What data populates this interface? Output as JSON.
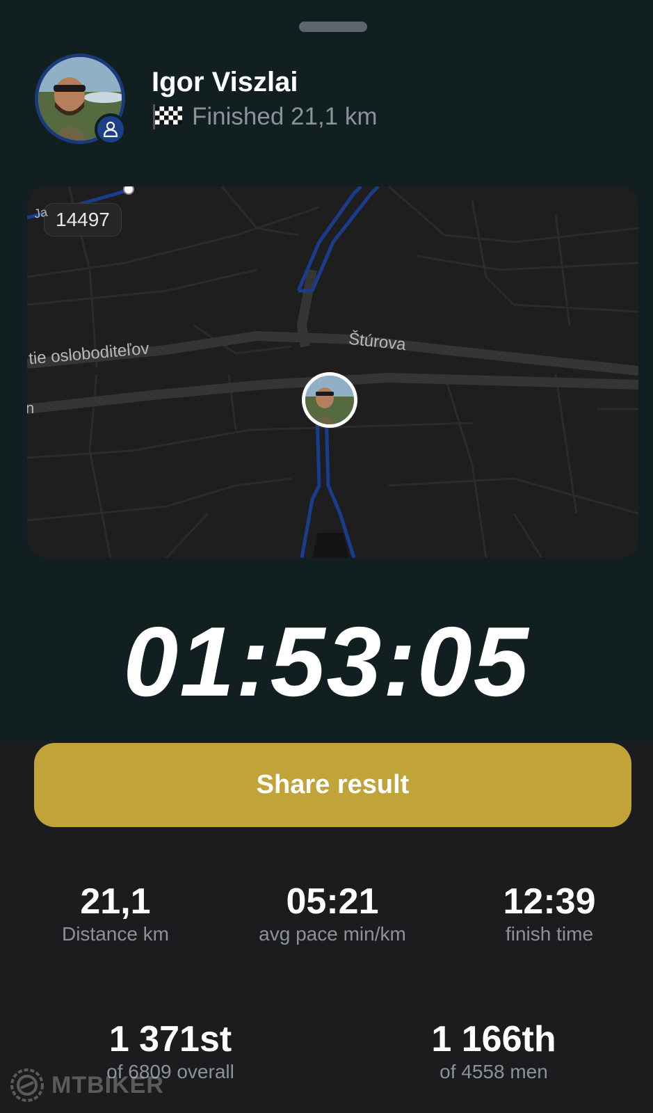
{
  "user": {
    "name": "Igor Viszlai",
    "status": "Finished 21,1 km"
  },
  "map": {
    "bib_number": "14497",
    "street_labels": [
      "tie osloboditeľov",
      "Štúrova",
      "Ja",
      "n"
    ]
  },
  "result": {
    "finish_time": "01:53:05"
  },
  "actions": {
    "share_label": "Share result"
  },
  "stats": [
    {
      "value": "21,1",
      "label": "Distance km"
    },
    {
      "value": "05:21",
      "label": "avg pace min/km"
    },
    {
      "value": "12:39",
      "label": "finish time"
    }
  ],
  "rankings": [
    {
      "value": "1 371st",
      "label": "of 6809 overall"
    },
    {
      "value": "1 166th",
      "label": "of 4558 men"
    }
  ],
  "watermark": "MTBIKER",
  "colors": {
    "top_panel": "#121f20",
    "background": "#1c1c1e",
    "accent_button": "#c0a43a",
    "route": "#1b3c8c",
    "muted_text": "#8a929c"
  },
  "icons": [
    "user-icon",
    "checkered-flag-icon"
  ]
}
